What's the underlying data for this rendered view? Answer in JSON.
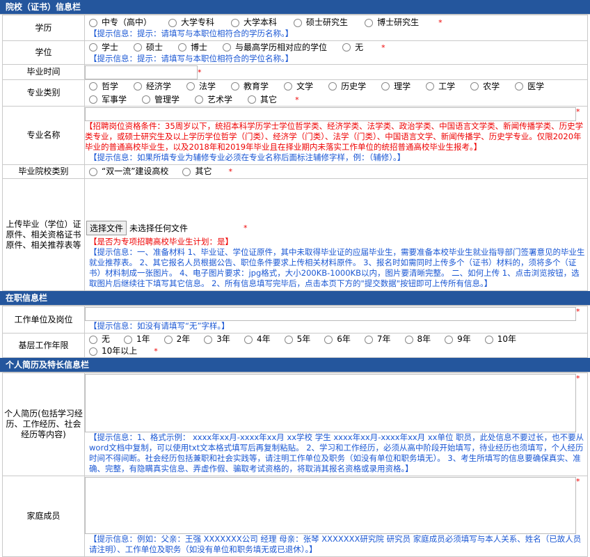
{
  "education_section": {
    "title": "院校（证书）信息栏",
    "degree_level": {
      "label": "学历",
      "options": [
        "中专（高中）",
        "大学专科",
        "大学本科",
        "硕士研究生",
        "博士研究生"
      ],
      "required_mark": "*",
      "hint": "【提示信息：提示：请填写与本职位相符合的学历名称。】"
    },
    "degree": {
      "label": "学位",
      "options": [
        "学士",
        "硕士",
        "博士",
        "与最高学历相对应的学位",
        "无"
      ],
      "required_mark": "*",
      "hint": "【提示信息：提示：请填写与本职位相符合的学位名称。】"
    },
    "graduation_date": {
      "label": "毕业时间",
      "value": "",
      "required_mark": "*"
    },
    "major_category": {
      "label": "专业类别",
      "options": [
        "哲学",
        "经济学",
        "法学",
        "教育学",
        "文学",
        "历史学",
        "理学",
        "工学",
        "农学",
        "医学",
        "军事学",
        "管理学",
        "艺术学",
        "其它"
      ],
      "required_mark": "*"
    },
    "major_name": {
      "label": "专业名称",
      "value": "",
      "required_mark": "*",
      "red_notice": "【招聘岗位资格条件：35周岁以下，统招本科学历学士学位哲学类、经济学类、法学类、政治学类、中国语言文学类、新闻传播学类、历史学类专业，或硕士研究生及以上学历学位哲学（门类）、经济学（门类）、法学（门类）、中国语言文学、新闻传播学、历史学专业。仅限2020年毕业的普通高校毕业生，以及2018年和2019年毕业且在择业期内未落实工作单位的统招普通高校毕业生报考。】",
      "hint": "【提示信息：如果所填专业为辅修专业必须在专业名称后面标注辅修字样，例：（辅修）。】"
    },
    "school_type": {
      "label": "毕业院校类别",
      "options": [
        "“双一流”建设高校",
        "其它"
      ],
      "required_mark": "*"
    },
    "upload": {
      "label": "上传毕业（学位）证原件、相关资格证书原件、相关推荐表等",
      "button_label": "选择文件",
      "file_status": "未选择任何文件",
      "required_mark": "*",
      "red_notice": "【是否为专项招聘高校毕业生计划：是】",
      "hint": "【提示信息：一、准备材料 1、毕业证、学位证原件，其中未取得毕业证的应届毕业生，需要准备本校毕业生就业指导部门签署意见的毕业生就业推荐表。 2、其它报名人员根据公告、职位条件要求上传相关材料原件。 3、报名时如需同时上传多个（证书）材料的，须将多个（证书）材料制成一张图片。 4、电子图片要求：jpg格式，大小200KB-1000KB以内，图片要清晰完整。 二、如何上传 1、点击浏览按钮，选取图片后继续往下填写其它信息。 2、所有信息填写完毕后，点击本页下方的\"提交数据\"按钮即可上传所有信息。】"
    }
  },
  "employment_section": {
    "title": "在职信息栏",
    "employer": {
      "label": "工作单位及岗位",
      "value": "",
      "required_mark": "*",
      "hint": "【提示信息：如没有请填写“无”字样。】"
    },
    "grassroots_years": {
      "label": "基层工作年限",
      "options": [
        "无",
        "1年",
        "2年",
        "3年",
        "4年",
        "5年",
        "6年",
        "7年",
        "8年",
        "9年",
        "10年",
        "10年以上"
      ],
      "required_mark": "*"
    }
  },
  "resume_section": {
    "title": "个人简历及特长信息栏",
    "resume": {
      "label": "个人简历(包括学习经历、工作经历、社会经历等内容)",
      "value": "",
      "required_mark": "*",
      "hint": "【提示信息：1、格式示例： xxxx年xx月-xxxx年xx月 xx学校 学生 xxxx年xx月-xxxx年xx月 xx单位 职员，此处信息不要过长，也不要从word文档中复制，可以使用txt文本格式填写后再复制粘贴。 2、学习和工作经历，必须从高中阶段开始填写，待业经历也须填写，个人经历时间不得间断。社会经历包括兼职和社会实践等，请注明工作单位及职务（如没有单位和职务填无）。 3、考生所填写的信息要确保真实、准确、完整，有隐瞒真实信息、弄虚作假、骗取考试资格的，将取消其报名资格或录用资格。】"
    },
    "family": {
      "label": "家庭成员",
      "value": "",
      "required_mark": "*",
      "hint": "【提示信息：例如：父亲：王强 XXXXXXX公司 经理 母亲：张琴 XXXXXXX研究院 研究员 家庭成员必须填写与本人关系、姓名（已故人员请注明）、工作单位及职务（如没有单位和职务填无或已退休）。】"
    }
  },
  "colors": {
    "header_bg": "#24569d",
    "hint": "#1a57d4",
    "required": "#e00000"
  }
}
